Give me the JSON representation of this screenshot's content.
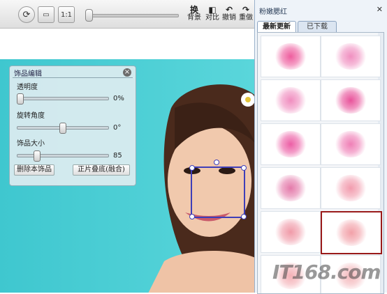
{
  "toolbar": {
    "buttons": {
      "refresh_icon": "refresh-icon",
      "monitor_icon": "monitor-icon",
      "actual_size_label": "1:1"
    },
    "zoom_slider": {
      "value": 0
    },
    "actions": [
      {
        "top": "换",
        "bottom": "背景"
      },
      {
        "top": "◧",
        "bottom": "对比"
      },
      {
        "top": "↶",
        "bottom": "撤销"
      },
      {
        "top": "↷",
        "bottom": "重做"
      }
    ]
  },
  "editor": {
    "title": "饰品编辑",
    "opacity": {
      "label": "透明度",
      "value": "0%",
      "level": 0
    },
    "rotation": {
      "label": "旋转角度",
      "value": "0°",
      "level": 0.5
    },
    "size": {
      "label": "饰品大小",
      "value": "85",
      "level": 0.2
    },
    "delete_button": "删除本饰品",
    "blend_button": "正片叠底(融合)"
  },
  "panel": {
    "title": "粉嫩腮红",
    "tabs": [
      "最新更新",
      "已下载"
    ],
    "thumbnails": [
      {
        "color": "#ee5d9e"
      },
      {
        "color": "#f08fc0"
      },
      {
        "color": "#f08dbf"
      },
      {
        "color": "#e8529a"
      },
      {
        "color": "#ec5ea5"
      },
      {
        "color": "#ef7fb6"
      },
      {
        "color": "#e47aaa"
      },
      {
        "color": "#f29cae"
      },
      {
        "color": "#f09aa8"
      },
      {
        "color": "#f2a0a8"
      },
      {
        "color": "#f4b0b6"
      },
      {
        "color": "#f4b8bc"
      }
    ],
    "selected_index": 9
  },
  "watermark": "IT168.com",
  "colors": {
    "accent_selection": "#3e3eb8",
    "selected_border": "#9a1a1a"
  }
}
